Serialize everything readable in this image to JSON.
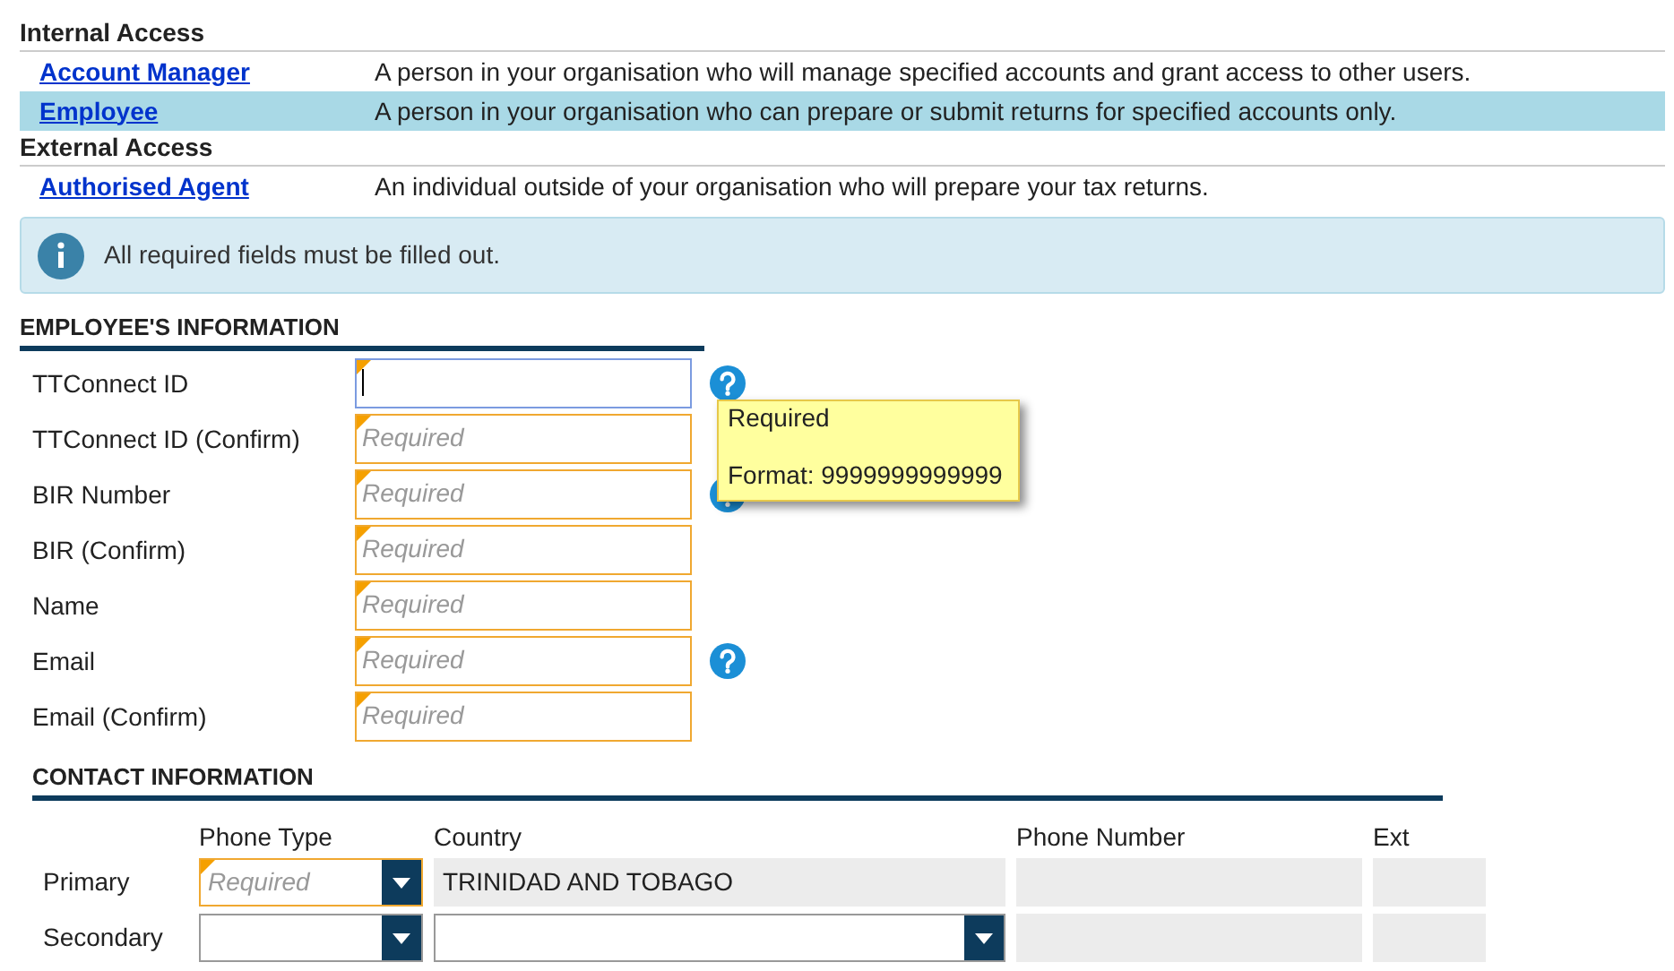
{
  "access_groups": [
    {
      "title": "Internal Access",
      "roles": [
        {
          "name": "Account Manager",
          "description": "A person in your organisation who will manage specified accounts and grant access to other users.",
          "selected": false
        },
        {
          "name": "Employee",
          "description": "A person in your organisation who can prepare or submit returns for specified accounts only.",
          "selected": true
        }
      ]
    },
    {
      "title": "External Access",
      "roles": [
        {
          "name": "Authorised Agent",
          "description": "An individual outside of your organisation who will prepare your tax returns.",
          "selected": false
        }
      ]
    }
  ],
  "notice": "All required fields must be filled out.",
  "employee_section": {
    "title": "EMPLOYEE'S INFORMATION",
    "fields": [
      {
        "label": "TTConnect ID",
        "focused": true,
        "help": true
      },
      {
        "label": "TTConnect ID (Confirm)",
        "placeholder": "Required",
        "focused": false,
        "help": false
      },
      {
        "label": "BIR Number",
        "placeholder": "Required",
        "focused": false,
        "help": true
      },
      {
        "label": "BIR (Confirm)",
        "placeholder": "Required",
        "focused": false,
        "help": false
      },
      {
        "label": "Name",
        "placeholder": "Required",
        "focused": false,
        "help": false
      },
      {
        "label": "Email",
        "placeholder": "Required",
        "focused": false,
        "help": true
      },
      {
        "label": "Email (Confirm)",
        "placeholder": "Required",
        "focused": false,
        "help": false
      }
    ]
  },
  "tooltip": {
    "lines": [
      "Required",
      "Format: 9999999999999"
    ]
  },
  "contact_section": {
    "title": "CONTACT INFORMATION",
    "columns": [
      "Phone Type",
      "Country",
      "Phone Number",
      "Ext"
    ],
    "rows": [
      {
        "label": "Primary",
        "phone_type": {
          "placeholder": "Required",
          "required": true
        },
        "country": {
          "kind": "readonly",
          "value": "TRINIDAD AND TOBAGO"
        }
      },
      {
        "label": "Secondary",
        "phone_type": {
          "required": false
        },
        "country": {
          "kind": "select"
        }
      }
    ]
  }
}
